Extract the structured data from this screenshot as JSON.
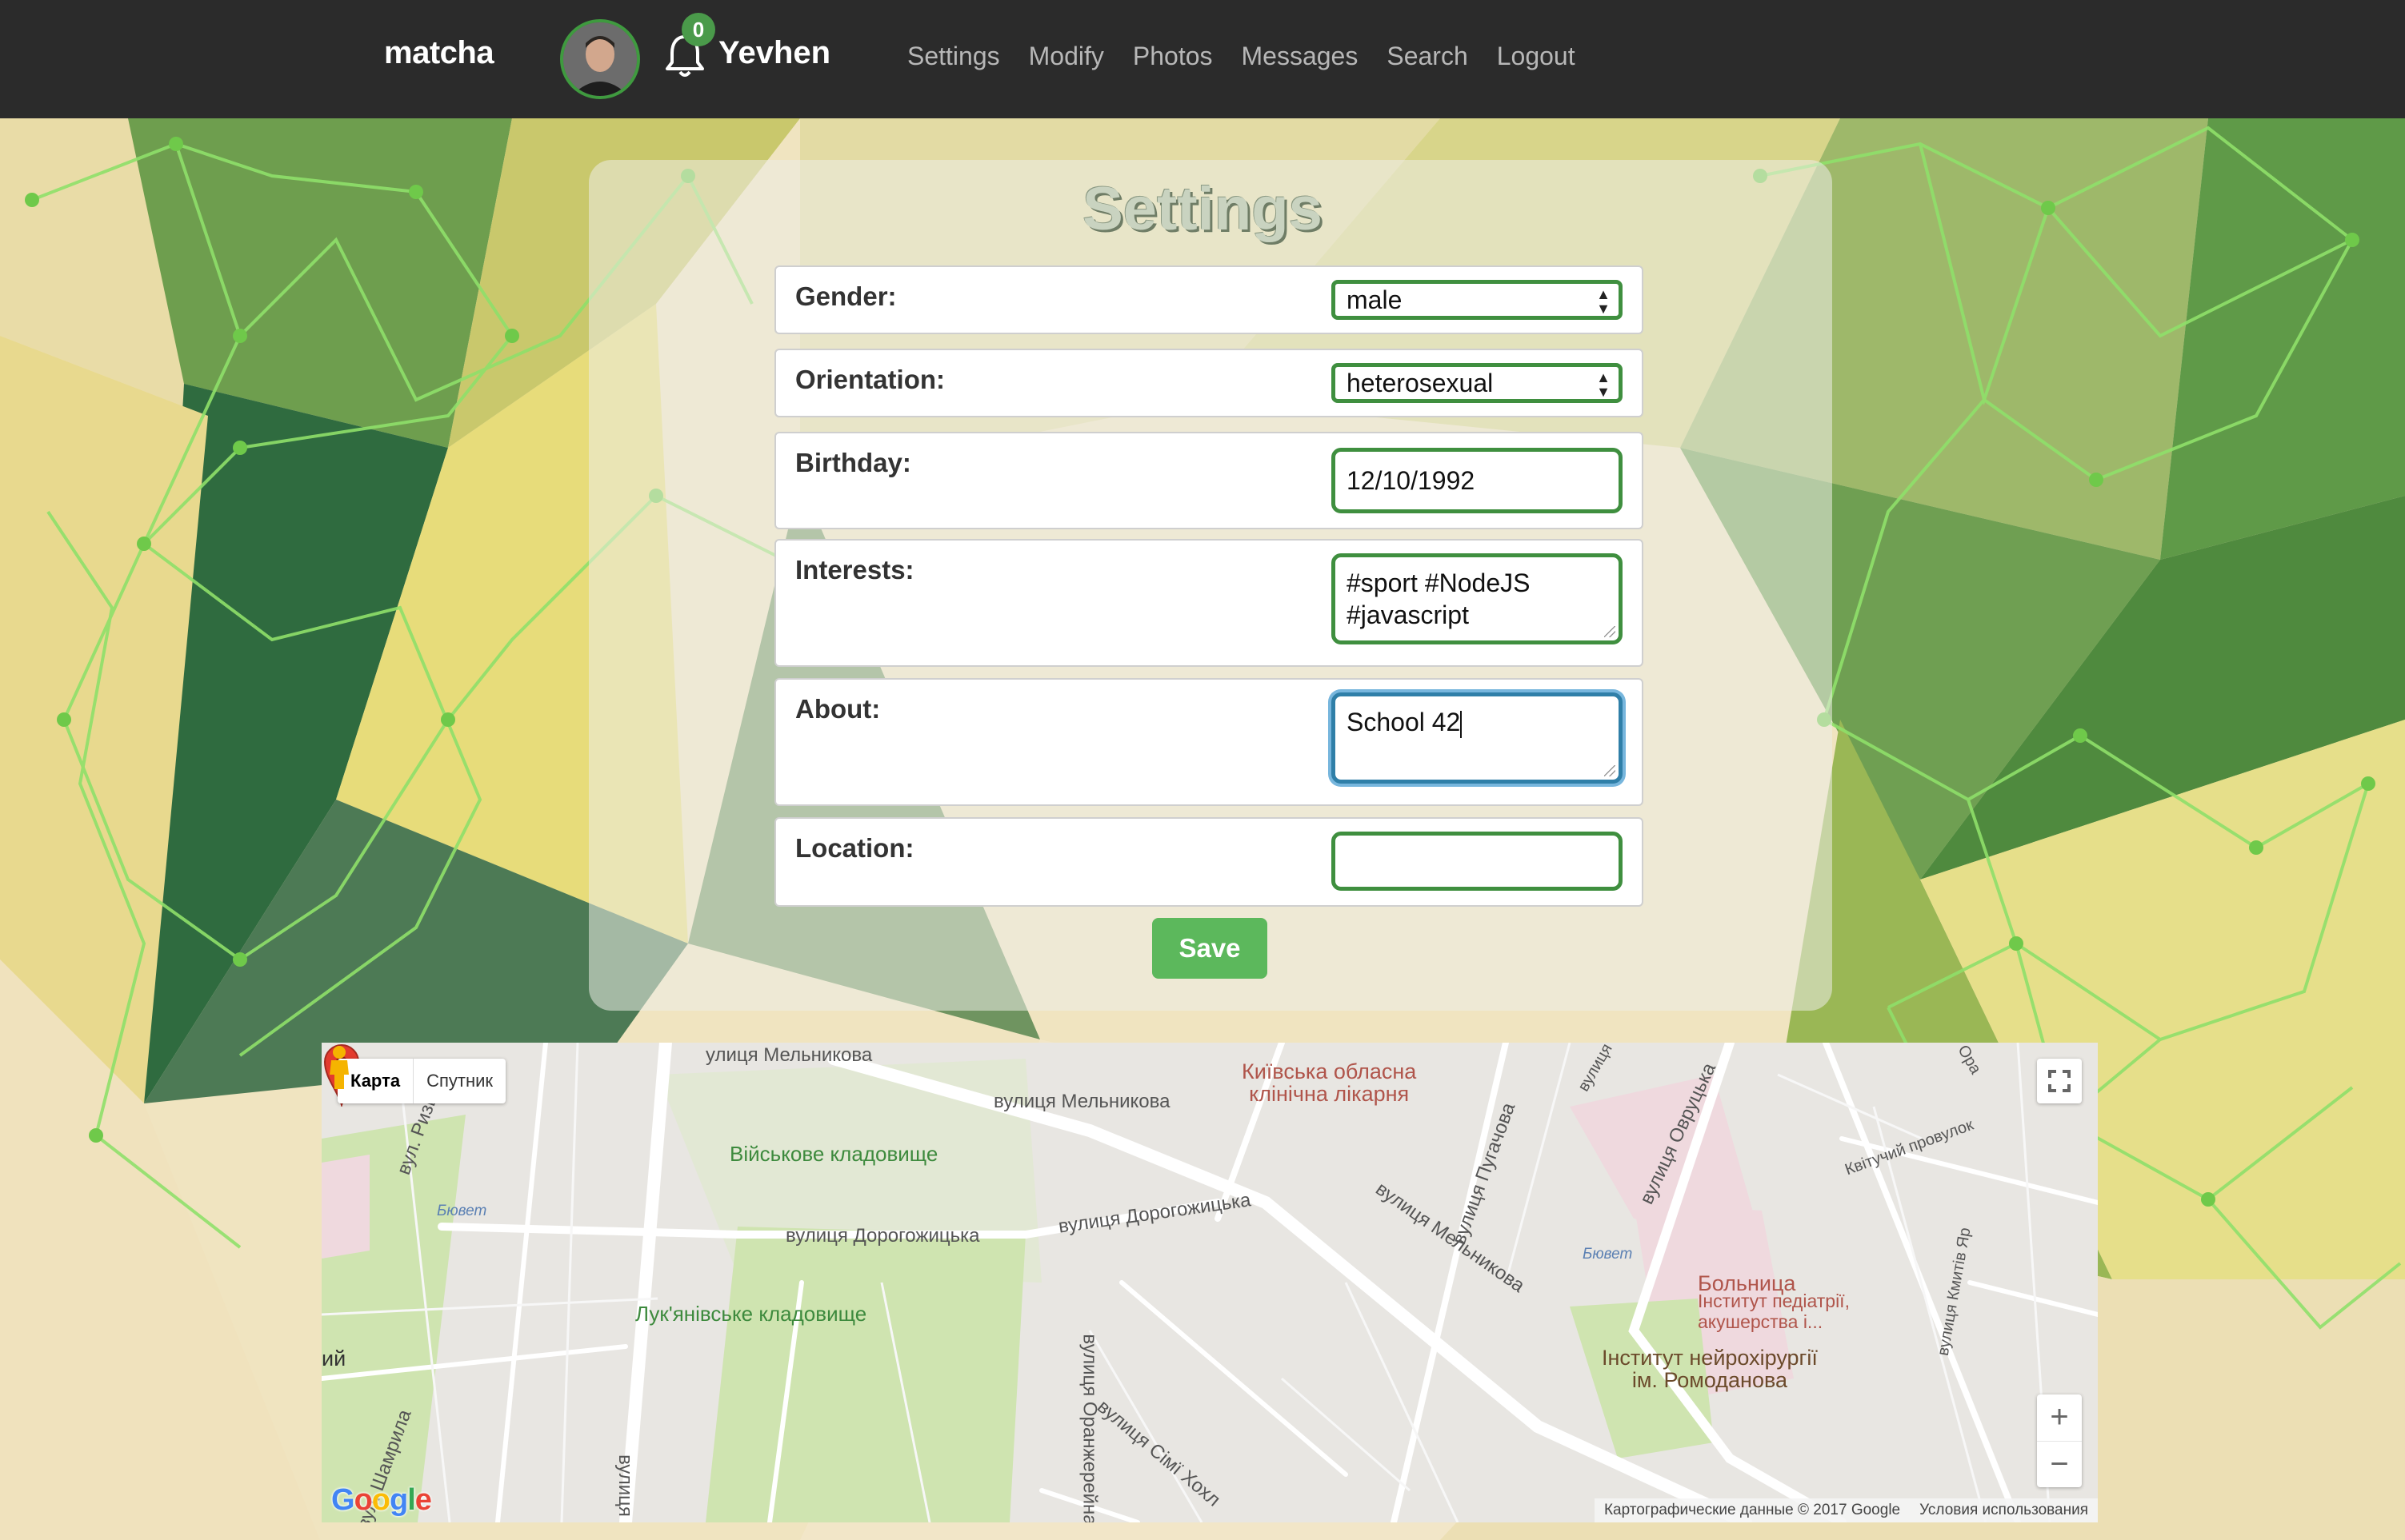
{
  "navbar": {
    "brand": "matcha",
    "notification_count": "0",
    "username": "Yevhen",
    "links": [
      "Settings",
      "Modify",
      "Photos",
      "Messages",
      "Search",
      "Logout"
    ]
  },
  "settings": {
    "title": "Settings",
    "gender": {
      "label": "Gender:",
      "value": "male"
    },
    "orientation": {
      "label": "Orientation:",
      "value": "heterosexual"
    },
    "birthday": {
      "label": "Birthday:",
      "value": "12/10/1992"
    },
    "interests": {
      "label": "Interests:",
      "line1": "#sport #NodeJS",
      "line2": "#javascript"
    },
    "about": {
      "label": "About:",
      "value": "School 42"
    },
    "location": {
      "label": "Location:",
      "value": ""
    },
    "save_label": "Save"
  },
  "map": {
    "type_buttons": [
      "Карта",
      "Спутник"
    ],
    "footer_data": "Картографические данные © 2017 Google",
    "footer_terms": "Условия использования",
    "logo": "Google",
    "labels": {
      "melnykova_top": "улиця Мельникова",
      "melnykova_mid": "вулиця Мельникова",
      "melnykova_diag": "вулиця Мельникова",
      "military_cemetery": "Військове кладовище",
      "dorohozhytska_left": "вулиця Дорогожицька",
      "dorohozhytska_right": "вулиця Дорогожицька",
      "lukianivske": "Лук'янівське кладовище",
      "orangereina": "вулиця Оранжерейна",
      "simi_khokh": "вулиця Сімї Хохл",
      "shamryla": "вул. Шамрила",
      "hospital_line1": "Київська обласна",
      "hospital_line2": "клінічна лікарня",
      "puhachova": "вулиця Пугачова",
      "ovrutska": "вулиця Овруцька",
      "kvitchy": "Квітучий провулок",
      "bolnitsa": "Больница",
      "pediatrics_line1": "Інститут педіатрії,",
      "pediatrics_line2": "акушерства і...",
      "neuro_line1": "Інститут нейрохірургії",
      "neuro_line2": "ім. Ромоданова",
      "buvet_left": "Бювет",
      "buvet_right": "Бювет",
      "kmitiv": "вулиця Кмитів Яр",
      "left_edge": "ий",
      "vul_left": "вулиця",
      "vulitsa_top": "вулиця",
      "nizka": "вул. Ризька",
      "oria": "Ора"
    }
  },
  "colors": {
    "navbar_bg": "#2b2b2b",
    "accent_green": "#5cb85c",
    "input_border": "#3f8f3f",
    "focus_border": "#2f7fa8",
    "marker_red": "#e33b2e"
  },
  "icons": [
    "bell-icon",
    "avatar-image",
    "select-arrows-icon",
    "fullscreen-icon",
    "pegman-icon",
    "zoom-in-icon",
    "zoom-out-icon",
    "map-marker-icon"
  ]
}
